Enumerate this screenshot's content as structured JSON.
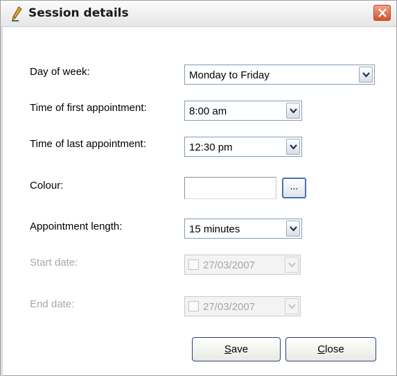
{
  "window": {
    "title": "Session details",
    "title_icon": "pencil-icon",
    "close_icon": "close-x-icon"
  },
  "form": {
    "day_of_week": {
      "label": "Day of week:",
      "value": "Monday to Friday"
    },
    "first_appointment": {
      "label": "Time of first appointment:",
      "value": "8:00 am"
    },
    "last_appointment": {
      "label": "Time of last appointment:",
      "value": "12:30 pm"
    },
    "colour": {
      "label": "Colour:",
      "value": "",
      "picker_label": "..."
    },
    "appointment_length": {
      "label": "Appointment length:",
      "value": "15 minutes"
    },
    "start_date": {
      "label": "Start date:",
      "value": "27/03/2007",
      "enabled": false,
      "checked": false
    },
    "end_date": {
      "label": "End date:",
      "value": "27/03/2007",
      "enabled": false,
      "checked": false
    }
  },
  "buttons": {
    "save": {
      "mnemonic": "S",
      "rest": "ave"
    },
    "close": {
      "mnemonic": "C",
      "rest": "lose"
    }
  },
  "colors": {
    "accent_border": "#7f9db9",
    "close_button": "#d5502c",
    "disabled_text": "#a7a7a7"
  }
}
